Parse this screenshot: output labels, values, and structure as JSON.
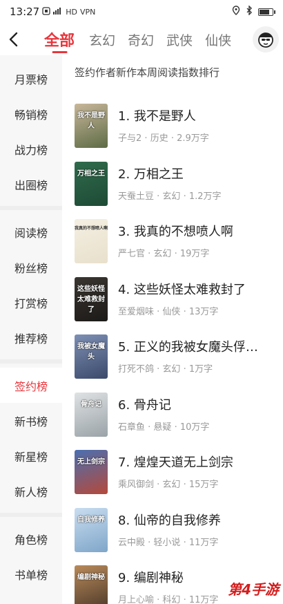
{
  "status_bar": {
    "time": "13:27",
    "left_icons": [
      "notification-icon",
      "signal-icon",
      "hd-icon",
      "vpn-icon"
    ],
    "hd_label": "HD",
    "vpn_label": "VPN",
    "right_icons": [
      "location-icon",
      "bluetooth-icon",
      "battery-icon"
    ],
    "battery_level": 0.85
  },
  "header": {
    "tabs": [
      {
        "label": "全部",
        "active": true
      },
      {
        "label": "玄幻",
        "active": false
      },
      {
        "label": "奇幻",
        "active": false
      },
      {
        "label": "武侠",
        "active": false
      },
      {
        "label": "仙侠",
        "active": false
      }
    ]
  },
  "sidebar": {
    "groups": [
      [
        "月票榜",
        "畅销榜",
        "战力榜",
        "出圈榜"
      ],
      [
        "阅读榜",
        "粉丝榜",
        "打赏榜",
        "推荐榜"
      ],
      [
        "签约榜",
        "新书榜",
        "新星榜",
        "新人榜"
      ],
      [
        "角色榜",
        "书单榜"
      ]
    ],
    "active": "签约榜"
  },
  "main": {
    "subtitle": "签约作者新作本周阅读指数排行",
    "books": [
      {
        "rank": "1.",
        "title": "我不是野人",
        "author": "子与2",
        "genre": "历史",
        "words": "2.9万字",
        "cover_text": "我不是野人",
        "cover_colors": [
          "#c8b79a",
          "#5d6b45"
        ]
      },
      {
        "rank": "2.",
        "title": "万相之王",
        "author": "天蚕土豆",
        "genre": "玄幻",
        "words": "1.2万字",
        "cover_text": "万相之王",
        "cover_colors": [
          "#2f6b4c",
          "#1e4a35"
        ]
      },
      {
        "rank": "3.",
        "title": "我真的不想喷人啊",
        "author": "严七官",
        "genre": "玄幻",
        "words": "19万字",
        "cover_text": "我真的不想喷人啊",
        "cover_colors": [
          "#f4efe2",
          "#e8e0cc"
        ]
      },
      {
        "rank": "4.",
        "title": "这些妖怪太难救封了",
        "author": "至爱烟味",
        "genre": "仙侠",
        "words": "13万字",
        "cover_text": "这些妖怪太难救封了",
        "cover_colors": [
          "#3a3530",
          "#1c1a18"
        ]
      },
      {
        "rank": "5.",
        "title": "正义的我被女魔头俘…",
        "author": "打死不鸽",
        "genre": "玄幻",
        "words": "1万字",
        "cover_text": "我被女魔头",
        "cover_colors": [
          "#7d8fb4",
          "#3b4a6b"
        ]
      },
      {
        "rank": "6.",
        "title": "骨舟记",
        "author": "石章鱼",
        "genre": "悬疑",
        "words": "10万字",
        "cover_text": "骨舟记",
        "cover_colors": [
          "#dfe2e4",
          "#9aa3a8"
        ]
      },
      {
        "rank": "7.",
        "title": "煌煌天道无上剑宗",
        "author": "乘风御剑",
        "genre": "玄幻",
        "words": "15万字",
        "cover_text": "无上剑宗",
        "cover_colors": [
          "#4a6fb0",
          "#b5493a"
        ]
      },
      {
        "rank": "8.",
        "title": "仙帝的自我修养",
        "author": "云中殿",
        "genre": "轻小说",
        "words": "11万字",
        "cover_text": "自我修养",
        "cover_colors": [
          "#c9ddf0",
          "#7fa6c9"
        ]
      },
      {
        "rank": "9.",
        "title": "编剧神秘",
        "author": "月上心喻",
        "genre": "科幻",
        "words": "11万字",
        "cover_text": "编剧神秘",
        "cover_colors": [
          "#b98a5a",
          "#4d3a2a"
        ]
      }
    ],
    "separator": " · "
  },
  "watermark": "第4手游"
}
